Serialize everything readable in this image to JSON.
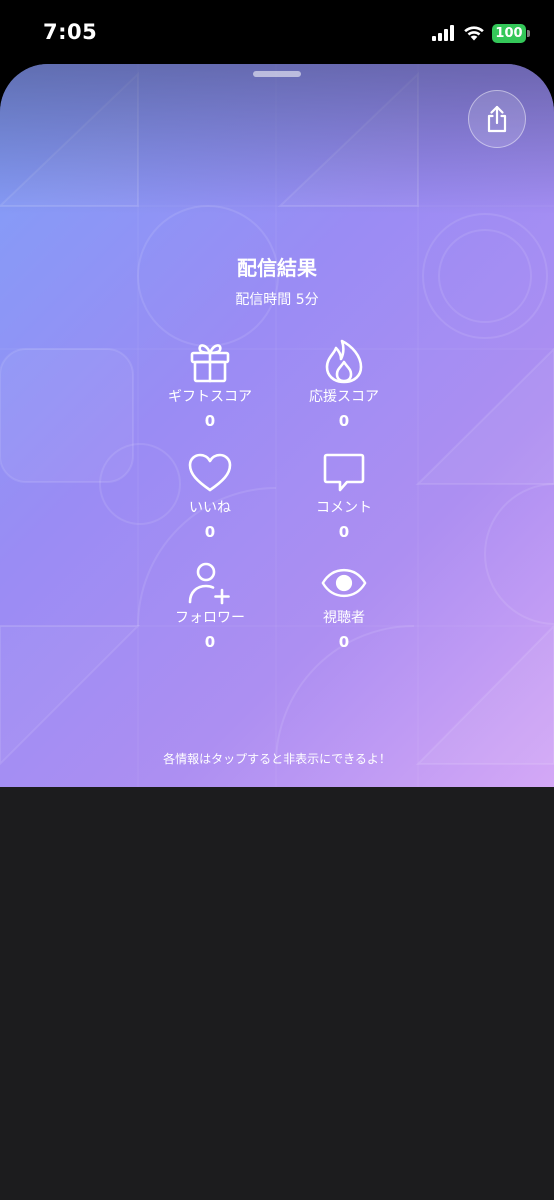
{
  "status_bar": {
    "time": "7:05",
    "battery": "100",
    "icons": [
      "cellular-signal-icon",
      "wifi-icon",
      "battery-icon"
    ]
  },
  "colors": {
    "gradient_start": "#7fa0f8",
    "gradient_mid": "#ad8ff2",
    "gradient_end": "#d4a8f6",
    "sheet_background": "#1c1c1e",
    "battery_green": "#34c759"
  },
  "result": {
    "title": "配信結果",
    "duration": "配信時間 5分"
  },
  "stats": [
    {
      "icon": "gift-icon",
      "label": "ギフトスコア",
      "value": "0"
    },
    {
      "icon": "flame-icon",
      "label": "応援スコア",
      "value": "0"
    },
    {
      "icon": "heart-icon",
      "label": "いいね",
      "value": "0"
    },
    {
      "icon": "comment-icon",
      "label": "コメント",
      "value": "0"
    },
    {
      "icon": "add-follower-icon",
      "label": "フォロワー",
      "value": "0"
    },
    {
      "icon": "eye-icon",
      "label": "視聴者",
      "value": "0"
    }
  ],
  "footer_hint": "各情報はタップすると非表示にできるよ！",
  "share_icon": "share-icon"
}
